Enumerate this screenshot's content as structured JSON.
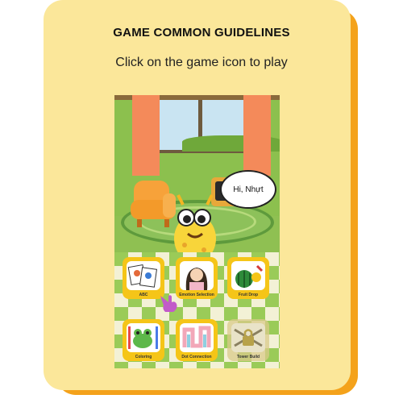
{
  "header": {
    "title": "GAME COMMON GUIDELINES",
    "subtitle": "Click on the game icon to play"
  },
  "scene": {
    "greeting": "Hi, Nhựt"
  },
  "games": [
    {
      "label": "ABC",
      "icon": "alphabet-cards-icon",
      "locked": false
    },
    {
      "label": "Emotion Selection",
      "icon": "girl-face-icon",
      "locked": false
    },
    {
      "label": "Fruit Drop",
      "icon": "watermelon-icon",
      "locked": false
    },
    {
      "label": "Coloring",
      "icon": "frog-crayons-icon",
      "locked": false
    },
    {
      "label": "Dot Connection",
      "icon": "pipes-icon",
      "locked": false
    },
    {
      "label": "Tower Build",
      "icon": "locked-icon",
      "locked": true
    }
  ],
  "colors": {
    "card": "#FBE79A",
    "card_shadow": "#F4A21B",
    "tile_yellow": "#F5C518",
    "pointer": "#C25BC9"
  }
}
